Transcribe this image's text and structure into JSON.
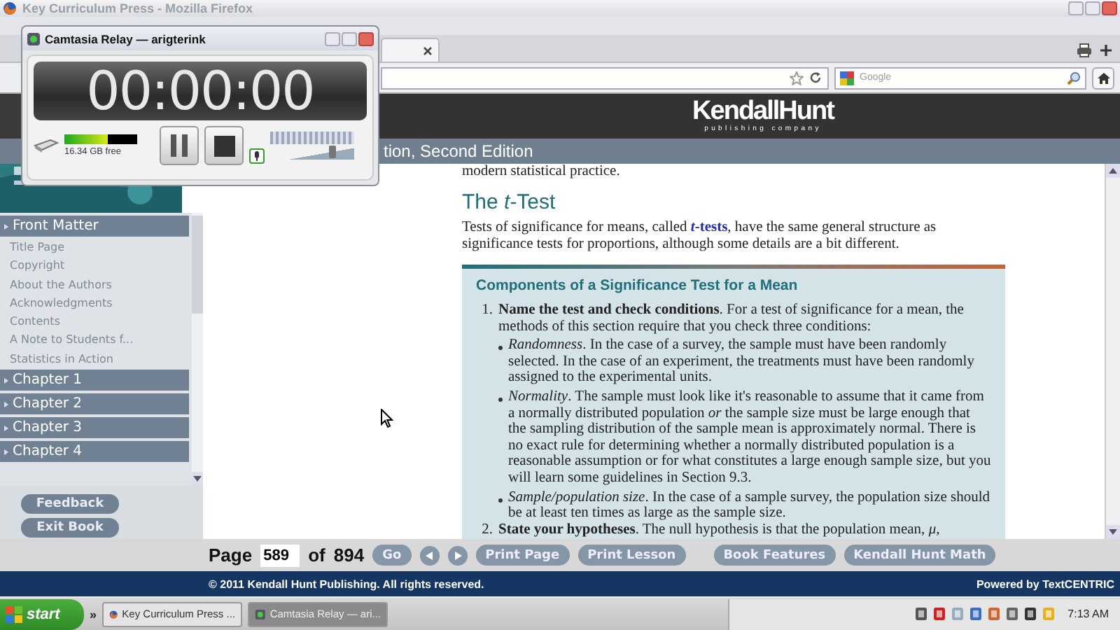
{
  "browser": {
    "title": "Key Curriculum Press - Mozilla Firefox",
    "search_placeholder": "Google"
  },
  "recorder": {
    "title": "Camtasia Relay — arigterink",
    "timer": "00:00:00",
    "storage": {
      "level": 0.6,
      "label": "16.34 GB free"
    },
    "volume": {
      "level": 0.75
    }
  },
  "header": {
    "logo": "KendallHunt",
    "logo_tagline": "publishing company",
    "subtitle": "tion, Second Edition"
  },
  "sidebar": {
    "sections": [
      {
        "label": "Front Matter",
        "children": [
          {
            "label": "Title Page"
          },
          {
            "label": "Copyright"
          },
          {
            "label": "About the Authors"
          },
          {
            "label": "Acknowledgments"
          },
          {
            "label": "Contents"
          },
          {
            "label": "A Note to Students f..."
          },
          {
            "label": "Statistics in Action"
          }
        ]
      },
      {
        "label": "Chapter 1"
      },
      {
        "label": "Chapter 2"
      },
      {
        "label": "Chapter 3"
      },
      {
        "label": "Chapter 4"
      }
    ],
    "buttons": [
      "Feedback",
      "Exit Book"
    ]
  },
  "article": {
    "lead": "modern statistical practice.",
    "heading": "The *t*-Test",
    "intro": {
      "before": "Tests of significance for means, called ",
      "link": "*t*-tests",
      "after": ", have the same general structure as significance tests for proportions, although some details are a bit different."
    },
    "box": {
      "title": "Components of a Significance Test for a Mean",
      "steps": [
        {
          "number": "1.",
          "text": "**Name the test and check conditions**. For a test of significance for a mean, the methods of this section require that you check three conditions:",
          "bullets": [
            "*Randomness*. In the case of a survey, the sample must have been randomly selected. In the case of an experiment, the treatments must have been randomly assigned to the experimental units.",
            "*Normality*. The sample must look like it's reasonable to assume that it came from a normally distributed population *or* the sample size must be large enough that the sampling distribution of the sample mean is approximately normal. There is no exact rule for determining whether a normally distributed population is a reasonable assumption or for what constitutes a large enough sample size, but you will learn some guidelines in Section 9.3.",
            "*Sample/population size*. In the case of a sample survey, the population size should be at least ten times as large as the sample size."
          ]
        },
        {
          "number": "2.",
          "text": "**State your hypotheses**. The null hypothesis is that the population mean, *μ*,"
        }
      ]
    }
  },
  "pager": {
    "label": "Page",
    "page": "589",
    "of": "of",
    "total": "894",
    "nav_buttons": [
      {
        "kind": "text",
        "label": "Go"
      },
      {
        "kind": "prev"
      },
      {
        "kind": "next"
      },
      {
        "kind": "text",
        "label": "Print Page"
      },
      {
        "kind": "text",
        "label": "Print Lesson"
      }
    ],
    "book_buttons": [
      {
        "kind": "text",
        "label": "Book Features"
      },
      {
        "kind": "text",
        "label": "Kendall Hunt Math"
      }
    ]
  },
  "footer": {
    "copyright": "© 2011 Kendall Hunt Publishing. All rights reserved.",
    "powered": "Powered by TextCENTRIC"
  },
  "taskbar": {
    "start": "start",
    "quick_launch": "»",
    "tasks": [
      {
        "kind": "browser",
        "label": "Key Curriculum Press ...",
        "selected": false
      },
      {
        "kind": "recorder",
        "label": "Camtasia Relay — ari...",
        "selected": true
      }
    ],
    "clock": "7:13 AM"
  }
}
